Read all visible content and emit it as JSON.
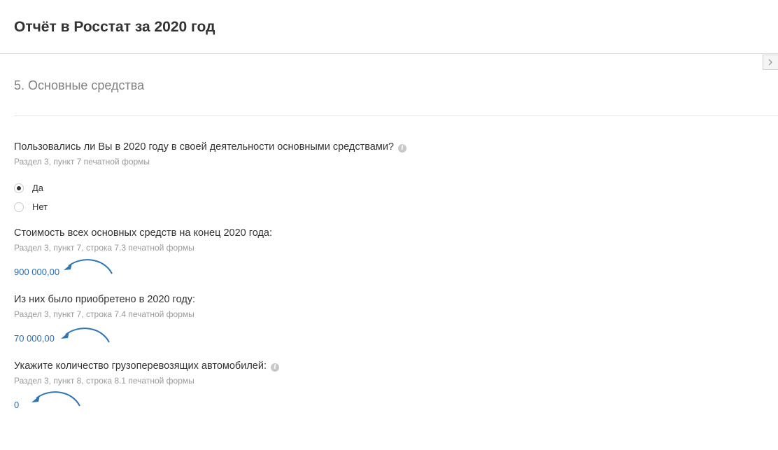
{
  "header": {
    "title": "Отчёт в Росстат за 2020 год"
  },
  "side_toggle": {
    "icon": "chevron-right-icon"
  },
  "section": {
    "title": "5. Основные средства"
  },
  "questions": [
    {
      "label": "Пользовались ли Вы в 2020 году в своей деятельности основными средствами?",
      "hint": "Раздел 3, пункт 7 печатной формы",
      "has_info_icon": true,
      "options": [
        {
          "label": "Да",
          "checked": true
        },
        {
          "label": "Нет",
          "checked": false
        }
      ]
    },
    {
      "label": "Стоимость всех основных средств на конец 2020 года:",
      "hint": "Раздел 3, пункт 7, строка 7.3 печатной формы",
      "value": "900 000,00"
    },
    {
      "label": "Из них было приобретено в 2020 году:",
      "hint": "Раздел 3, пункт 7, строка 7.4 печатной формы",
      "value": "70 000,00"
    },
    {
      "label": "Укажите количество грузоперевозящих автомобилей:",
      "hint": "Раздел 3, пункт 8, строка 8.1 печатной формы",
      "has_info_icon": true,
      "value": "0"
    }
  ],
  "colors": {
    "link": "#2a6cb3",
    "annotation_arrow": "#2e75b6"
  }
}
